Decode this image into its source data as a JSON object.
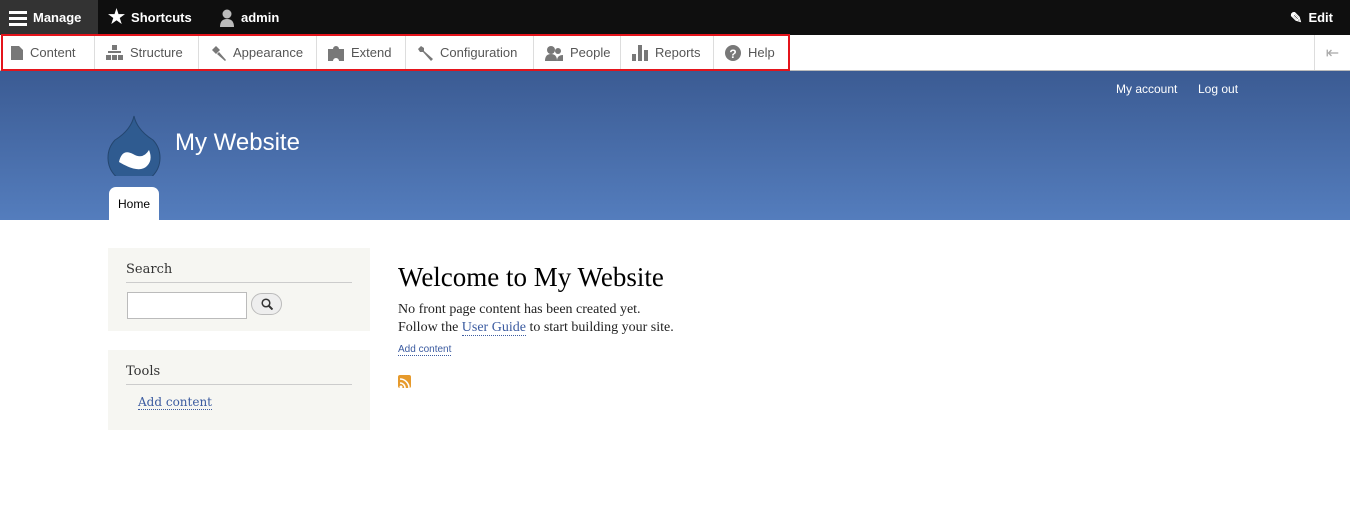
{
  "toolbar": {
    "manage": "Manage",
    "shortcuts": "Shortcuts",
    "user": "admin",
    "edit": "Edit"
  },
  "tray": {
    "items": [
      {
        "label": "Content"
      },
      {
        "label": "Structure"
      },
      {
        "label": "Appearance"
      },
      {
        "label": "Extend"
      },
      {
        "label": "Configuration"
      },
      {
        "label": "People"
      },
      {
        "label": "Reports"
      },
      {
        "label": "Help"
      }
    ]
  },
  "header": {
    "site_name": "My Website",
    "my_account": "My account",
    "log_out": "Log out",
    "home_tab": "Home"
  },
  "sidebar": {
    "search_title": "Search",
    "search_value": "",
    "tools_title": "Tools",
    "tools_link": "Add content"
  },
  "main": {
    "title": "Welcome to My Website",
    "line1": "No front page content has been created yet.",
    "line2_pre": "Follow the ",
    "line2_link": "User Guide",
    "line2_post": " to start building your site.",
    "add_content": "Add content"
  }
}
